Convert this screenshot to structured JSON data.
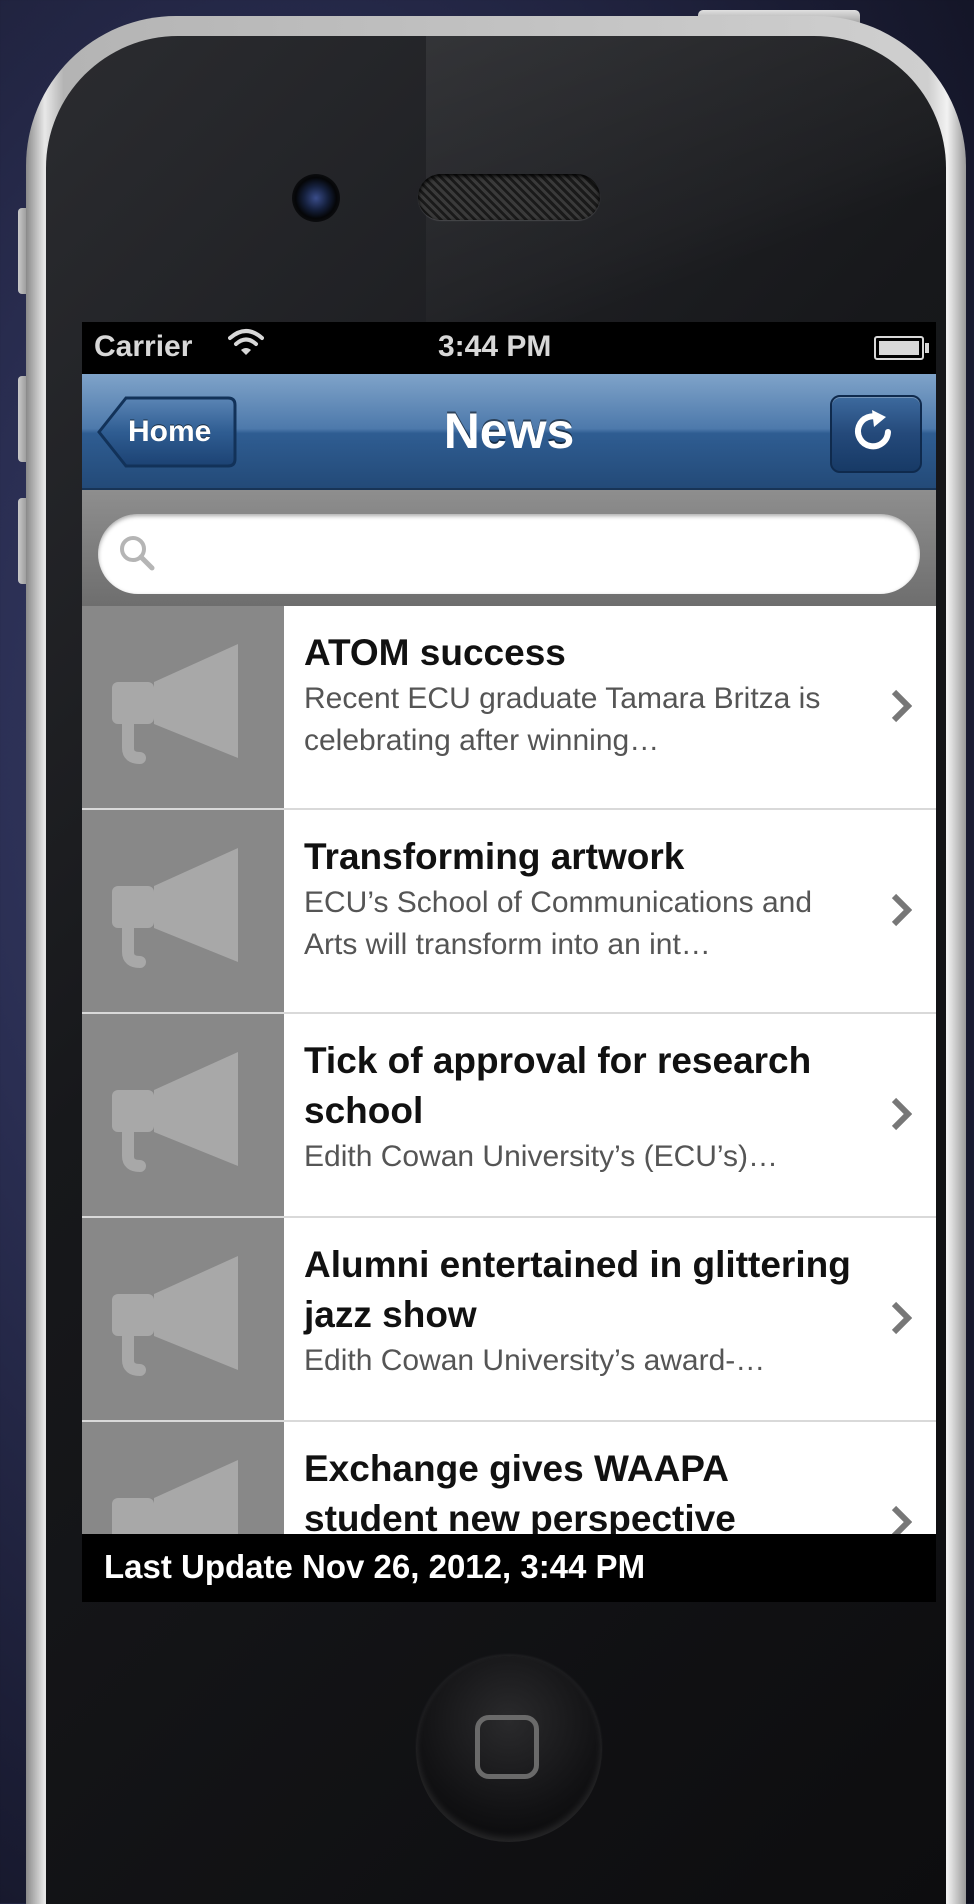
{
  "status_bar": {
    "carrier": "Carrier",
    "time": "3:44 PM"
  },
  "nav": {
    "back_label": "Home",
    "title": "News"
  },
  "search": {
    "placeholder": ""
  },
  "news_items": [
    {
      "title": "ATOM success",
      "summary": "Recent ECU graduate Tamara Britza is celebrating after winning…"
    },
    {
      "title": "Transforming artwork",
      "summary": "ECU’s School of Communications and Arts will transform into an int…"
    },
    {
      "title": "Tick of approval for research school",
      "summary": "Edith Cowan University’s (ECU’s)…"
    },
    {
      "title": "Alumni entertained in glittering jazz show",
      "summary": "Edith Cowan University’s award-…"
    },
    {
      "title": "Exchange gives WAAPA student new perspective",
      "summary": ""
    }
  ],
  "footer": {
    "last_update": "Last Update Nov 26, 2012, 3:44 PM"
  },
  "colors": {
    "navbar": "#4d79ab",
    "thumb_background": "#888888",
    "megaphone": "#a8a8a8"
  },
  "icons": [
    "wifi-icon",
    "battery-icon",
    "refresh-icon",
    "search-icon",
    "megaphone-icon",
    "chevron-right-icon",
    "home-button-icon"
  ]
}
